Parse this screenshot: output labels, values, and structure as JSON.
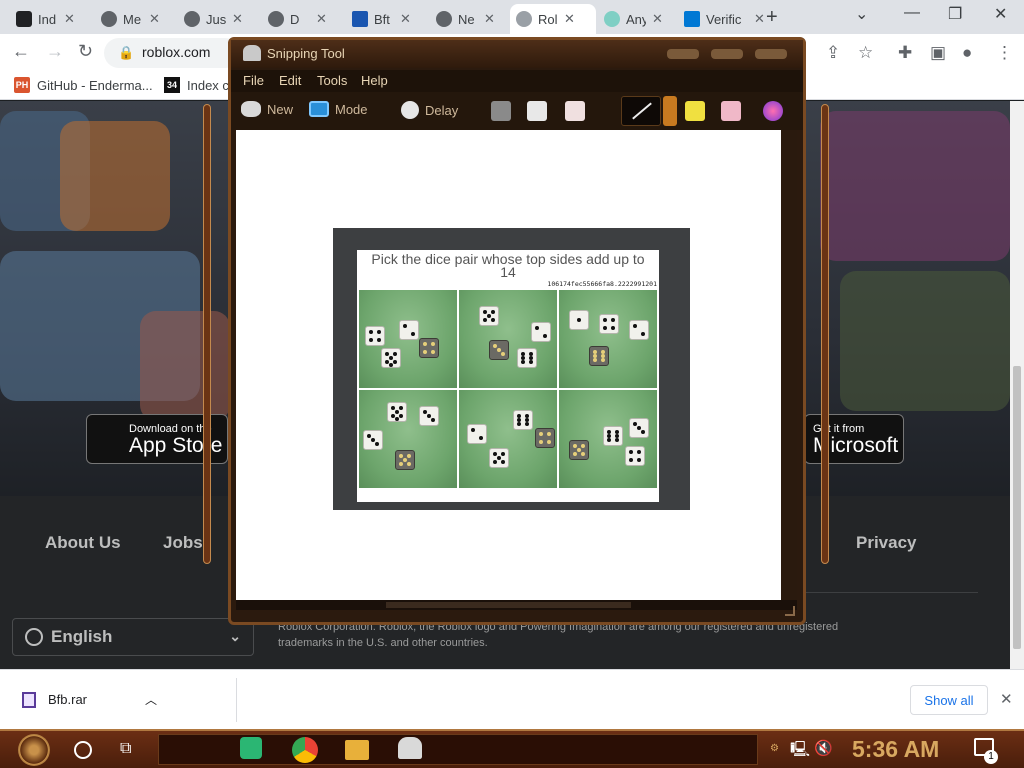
{
  "browser": {
    "tabs": [
      {
        "label": "Ind",
        "color": "#202124"
      },
      {
        "label": "Me",
        "color": "#5f6368"
      },
      {
        "label": "Jus",
        "color": "#5f6368"
      },
      {
        "label": "D",
        "color": "#5f6368"
      },
      {
        "label": "Bft",
        "color": "#1a56b0"
      },
      {
        "label": "Ne",
        "color": "#5f6368"
      },
      {
        "label": "Rol",
        "color": "#9aa0a6"
      },
      {
        "label": "Any",
        "color": "#7fcfc4"
      },
      {
        "label": "Verific",
        "color": "#0078d4"
      }
    ],
    "url": "roblox.com",
    "bookmarks": [
      {
        "label": "GitHub - Enderma...",
        "icon": "PH",
        "color": "#da552f"
      },
      {
        "label": "Index c",
        "icon": "34",
        "color": "#111111"
      }
    ],
    "download": {
      "filename": "Bfb.rar",
      "show_all": "Show all"
    }
  },
  "roblox_page": {
    "app_store": {
      "small": "Download on the",
      "big": "App Store"
    },
    "microsoft": {
      "small": "Get it from",
      "big": "Microsoft"
    },
    "footer_links": [
      "About Us",
      "Jobs",
      "Privacy"
    ],
    "language": "English",
    "legal_line1": "Roblox Corporation. Roblox, the Roblox logo and Powering Imagination are among our registered and unregistered",
    "legal_line2": "trademarks in the U.S. and other countries."
  },
  "snipping_tool": {
    "title": "Snipping Tool",
    "menu": [
      "File",
      "Edit",
      "Tools",
      "Help"
    ],
    "toolbar": {
      "new": "New",
      "mode": "Mode",
      "delay": "Delay"
    },
    "captcha": {
      "question": "Pick the dice pair whose top sides add up to 14",
      "id": "106174fec55666fa8.2222991201"
    }
  },
  "taskbar": {
    "time": "5:36 AM",
    "notification_count": "1"
  },
  "colors": {
    "accent_copper": "#b07840",
    "chrome_tab_bg": "#dee1e6",
    "link_blue": "#1a73e8"
  }
}
